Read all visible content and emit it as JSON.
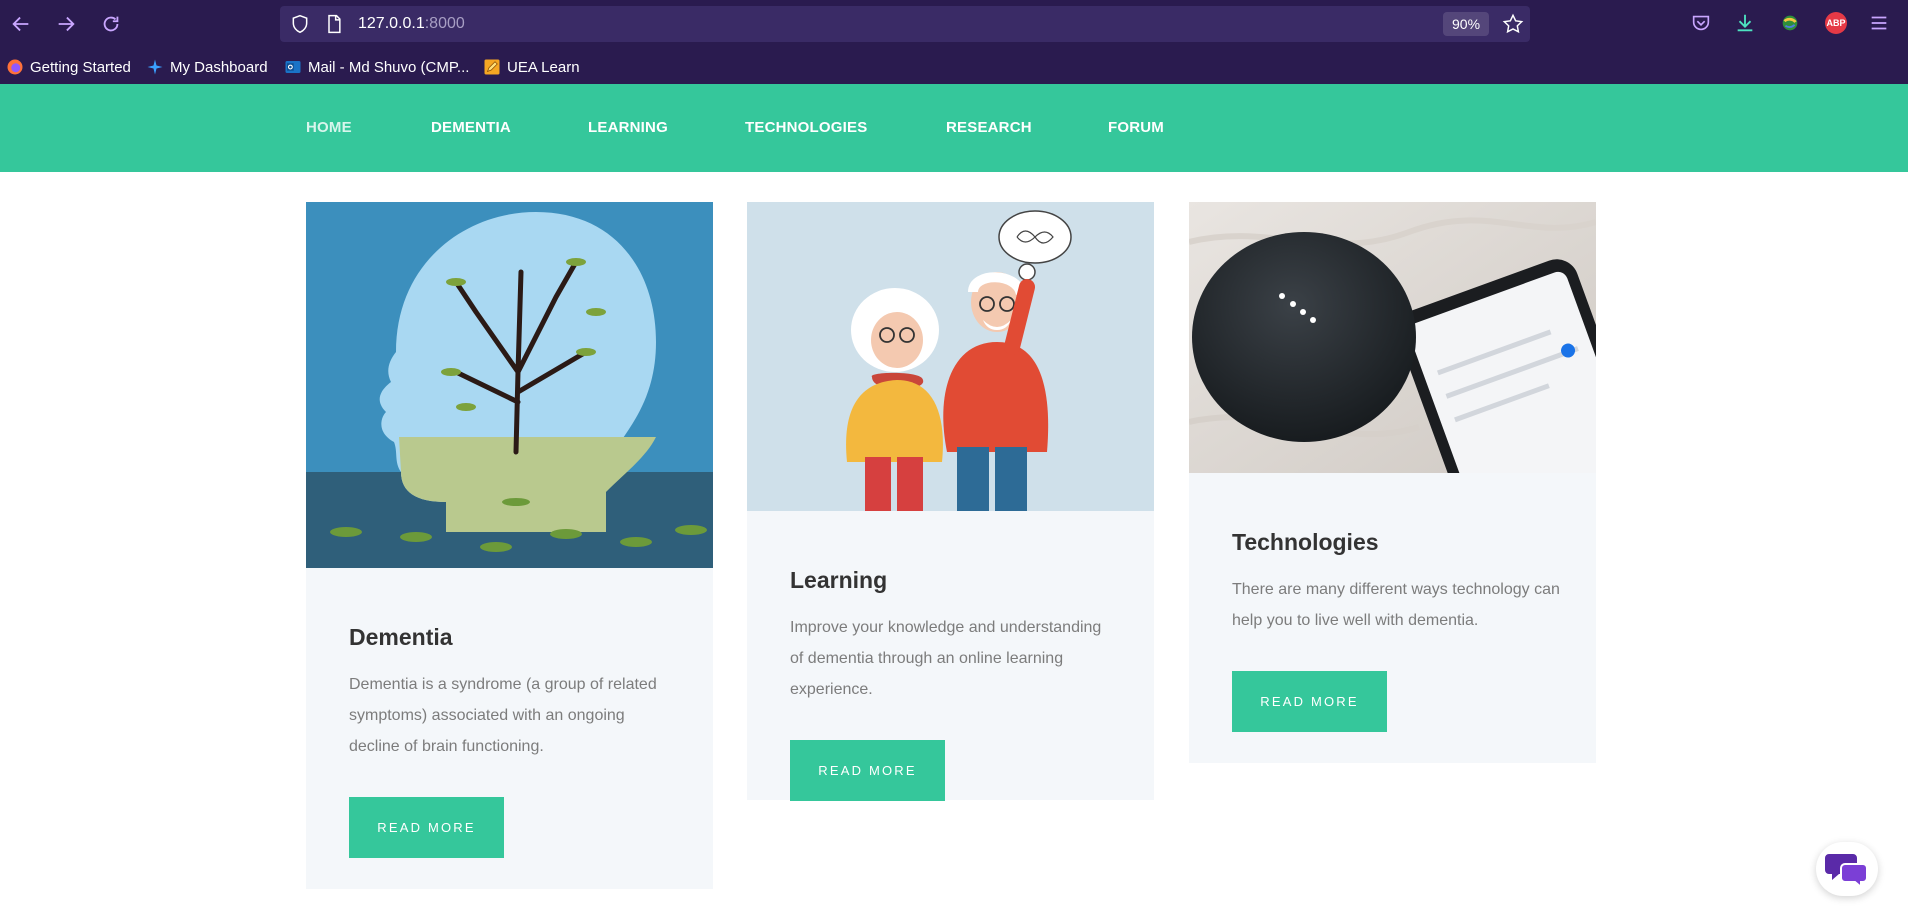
{
  "browser": {
    "url_host": "127.0.0.1",
    "url_port": ":8000",
    "zoom": "90%",
    "bookmarks": [
      {
        "label": "Getting Started"
      },
      {
        "label": "My Dashboard"
      },
      {
        "label": "Mail - Md Shuvo (CMP..."
      },
      {
        "label": "UEA Learn"
      }
    ],
    "abp_label": "ABP"
  },
  "nav": {
    "items": [
      "HOME",
      "DEMENTIA",
      "LEARNING",
      "TECHNOLOGIES",
      "RESEARCH",
      "FORUM"
    ]
  },
  "cards": [
    {
      "title": "Dementia",
      "text": "Dementia is a syndrome (a group of related symptoms) associated with an ongoing decline of brain functioning.",
      "button": "READ MORE",
      "image_icon": "tree-head-illustration"
    },
    {
      "title": "Learning",
      "text": "Improve your knowledge and understanding of dementia through an online learning experience.",
      "button": "READ MORE",
      "image_icon": "elderly-couple-illustration"
    },
    {
      "title": "Technologies",
      "text": "There are many different ways technology can help you to live well with dementia.",
      "button": "READ MORE",
      "image_icon": "smart-speaker-photo"
    }
  ],
  "colors": {
    "chrome": "#2a1b4f",
    "accent": "#35c79b",
    "card_bg": "#f4f7fa"
  }
}
